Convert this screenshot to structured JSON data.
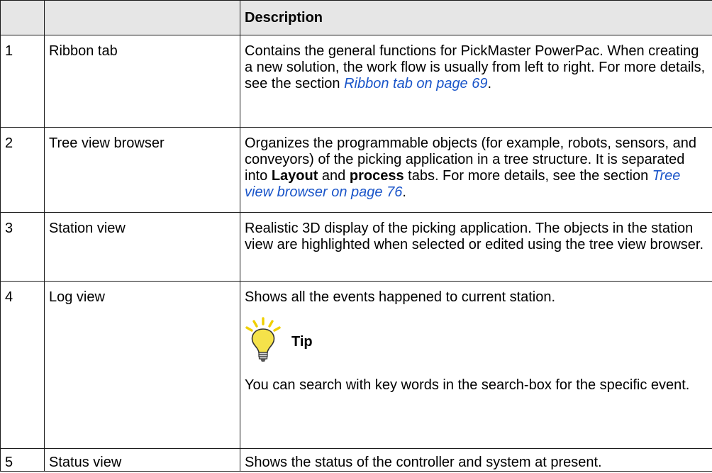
{
  "table": {
    "header": {
      "num": "",
      "label": "",
      "description": "Description"
    },
    "rows": [
      {
        "num": "1",
        "label": "Ribbon tab",
        "desc_a": "Contains the general functions for PickMaster PowerPac. When creating a new solution, the work flow is usually from left to right. For more details, see the section ",
        "desc_link": "Ribbon tab on page 69",
        "desc_b": "."
      },
      {
        "num": "2",
        "label": "Tree view browser",
        "desc_a": "Organizes the programmable objects (for example, robots, sensors, and conveyors) of the picking application in a tree structure. It is separated into ",
        "desc_bold1": "Layout",
        "desc_mid": " and ",
        "desc_bold2": "process",
        "desc_c": " tabs. For more details, see the section ",
        "desc_link": "Tree view browser on page 76",
        "desc_d": "."
      },
      {
        "num": "3",
        "label": "Station view",
        "desc": "Realistic 3D display of the picking application. The objects in the station view are highlighted when selected or edited using the tree view browser."
      },
      {
        "num": "4",
        "label": "Log view",
        "desc": "Shows all the events happened to current station.",
        "tip_title": "Tip",
        "tip_icon": "lightbulb-icon",
        "tip_text": "You can search with key words in the search-box for the specific event."
      },
      {
        "num": "5",
        "label": "Status view",
        "desc": "Shows the status of the controller and system at present."
      }
    ]
  },
  "colors": {
    "link": "#1a55c9",
    "header_bg": "#e6e6e6",
    "bulb": "#f5e24a",
    "rays": "#f0d000"
  }
}
